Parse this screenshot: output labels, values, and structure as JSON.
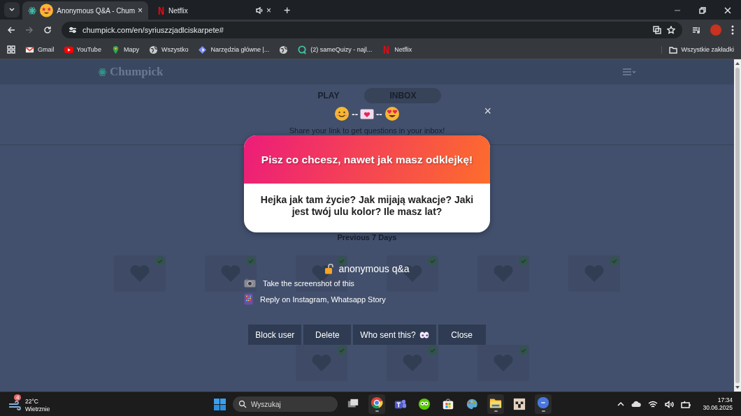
{
  "browser": {
    "tabs": [
      {
        "title": "Anonymous Q&A",
        "suffix": " - Chum",
        "kind": "site",
        "selected": true,
        "audio": false,
        "close": "×"
      },
      {
        "title": "Netflix",
        "kind": "netflix",
        "selected": false,
        "audio": true,
        "close": "×"
      }
    ],
    "new_tab": "+",
    "address": "chumpick.com/en/syriuszzjadlciskarpete#",
    "bookmarks": [
      {
        "kind": "gmail",
        "label": "Gmail"
      },
      {
        "kind": "youtube",
        "label": "YouTube"
      },
      {
        "kind": "maps",
        "label": "Mapy"
      },
      {
        "kind": "globe",
        "label": "Wszystko"
      },
      {
        "kind": "tools",
        "label": "Narzędzia główne |..."
      },
      {
        "kind": "globe"
      },
      {
        "kind": "quizy",
        "label": "(2) sameQuizy - najl..."
      },
      {
        "kind": "netflix",
        "label": "Netflix"
      }
    ],
    "all_bookmarks": "Wszystkie zakładki"
  },
  "page": {
    "logo": "Chumpick",
    "tabs": [
      {
        "label": "PLAY",
        "selected": false
      },
      {
        "label": "INBOX",
        "selected": true
      }
    ],
    "share_text": "Share your link to get questions in your inbox!",
    "section": "Previous 7 Days",
    "cards": [
      {
        "read": true
      },
      {
        "read": true
      },
      {
        "read": true
      },
      {
        "read": true
      },
      {
        "read": true
      },
      {
        "read": true
      },
      {
        "read": true
      },
      {
        "read": true
      },
      {
        "read": true
      }
    ]
  },
  "modal": {
    "decor": [
      {
        "kind": "smile"
      },
      {
        "kind": "dash",
        "text": "--"
      },
      {
        "kind": "letter"
      },
      {
        "kind": "dash",
        "text": "--"
      },
      {
        "kind": "heart_eyes"
      }
    ],
    "close": "×",
    "title": "Pisz co chcesz, nawet jak masz odklejkę!",
    "question": "Hejka jak tam życie? Jak mijają wakacje? Jaki jest twój ulu kolor? Ile masz lat?",
    "brand": "anonymous q&a",
    "tips": [
      {
        "kind": "camera",
        "text": "Take the screenshot of this"
      },
      {
        "kind": "phone",
        "text": "Reply on Instagram, Whatsapp Story"
      }
    ],
    "buttons": [
      {
        "label": "Block user",
        "kind": "plain"
      },
      {
        "label": "Delete",
        "kind": "plain"
      },
      {
        "label": "Who sent this?",
        "kind": "reveal"
      },
      {
        "label": "Close",
        "kind": "plain"
      }
    ]
  },
  "taskbar": {
    "weather_badge": "4",
    "temperature": "22°C",
    "weather": "Wietrznie",
    "search_placeholder": "Wyszukaj",
    "apps": [
      {
        "kind": "taskview",
        "running": false
      },
      {
        "kind": "chrome",
        "running": true
      },
      {
        "kind": "teams",
        "running": false
      },
      {
        "kind": "duo",
        "running": false
      },
      {
        "kind": "store",
        "running": false
      },
      {
        "kind": "paint",
        "running": false
      },
      {
        "kind": "files",
        "running": true
      },
      {
        "kind": "blocks",
        "running": false
      },
      {
        "kind": "canva",
        "running": true
      }
    ],
    "time": "17:34",
    "date": "30.06.2025"
  }
}
